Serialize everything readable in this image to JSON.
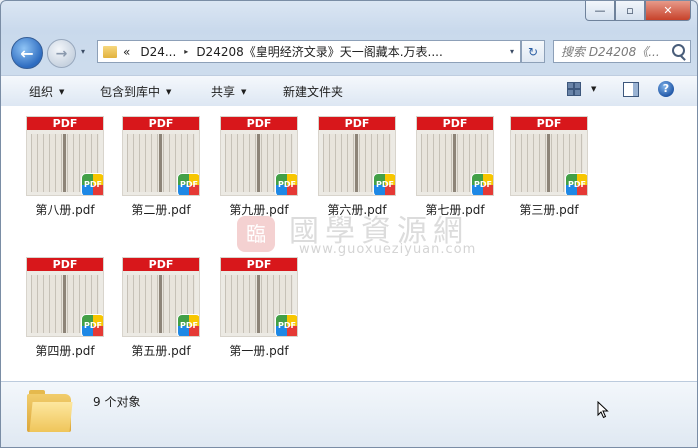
{
  "window": {
    "caption_minimize": "—",
    "caption_maximize": "▫",
    "caption_close": "✕"
  },
  "nav": {
    "back_glyph": "←",
    "forward_glyph": "→",
    "dropdown_glyph": "▾"
  },
  "address": {
    "overflow": "«",
    "segment_1": "D24...",
    "separator": "▸",
    "segment_2": "D24208《皇明经济文录》天一阁藏本.万表....",
    "dropdown_glyph": "▾"
  },
  "refresh": {
    "glyph": "↻"
  },
  "search": {
    "placeholder": "搜索 D24208《..."
  },
  "toolbar": {
    "organize": "组织",
    "include_in_library": "包含到库中",
    "share": "共享",
    "new_folder": "新建文件夹",
    "caret": "▼",
    "help": "?"
  },
  "files": [
    {
      "name": "第八册.pdf",
      "banner": "PDF",
      "badge": "PDF"
    },
    {
      "name": "第二册.pdf",
      "banner": "PDF",
      "badge": "PDF"
    },
    {
      "name": "第九册.pdf",
      "banner": "PDF",
      "badge": "PDF"
    },
    {
      "name": "第六册.pdf",
      "banner": "PDF",
      "badge": "PDF"
    },
    {
      "name": "第七册.pdf",
      "banner": "PDF",
      "badge": "PDF"
    },
    {
      "name": "第三册.pdf",
      "banner": "PDF",
      "badge": "PDF"
    },
    {
      "name": "第四册.pdf",
      "banner": "PDF",
      "badge": "PDF"
    },
    {
      "name": "第五册.pdf",
      "banner": "PDF",
      "badge": "PDF"
    },
    {
      "name": "第一册.pdf",
      "banner": "PDF",
      "badge": "PDF"
    }
  ],
  "watermark": {
    "seal": "臨",
    "text": "國學資源網",
    "url": "www.guoxueziyuan.com"
  },
  "status": {
    "item_count": "9 个对象"
  },
  "colors": {
    "pdf_banner": "#d8171b",
    "accent": "#2e6cc0"
  }
}
